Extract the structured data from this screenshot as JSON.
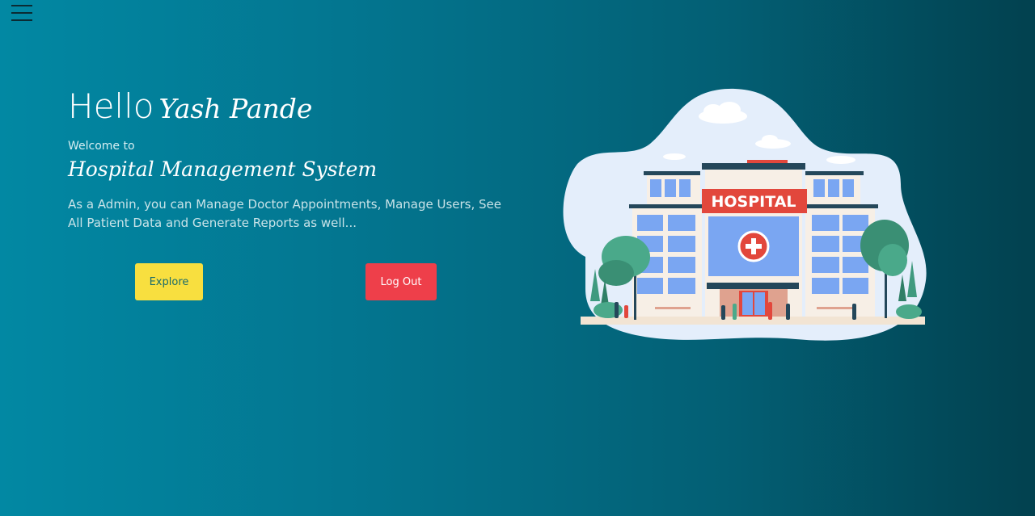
{
  "header": {
    "menu_icon": "hamburger-menu-icon"
  },
  "hero": {
    "greeting_prefix": "Hello",
    "user_name": "Yash Pande",
    "welcome_text": "Welcome to",
    "system_title": "Hospital Management System",
    "description": "As a Admin, you can Manage Doctor Appointments, Manage Users, See All Patient Data and Generate Reports as well..."
  },
  "actions": {
    "explore_label": "Explore",
    "logout_label": "Log Out"
  },
  "illustration": {
    "sign_text": "HOSPITAL",
    "icon": "hospital-building-illustration"
  },
  "colors": {
    "explore_button": "#f8df3f",
    "logout_button": "#ee3f4a",
    "sign": "#e2473c",
    "background_start": "#0288a3",
    "background_end": "#02414f"
  }
}
